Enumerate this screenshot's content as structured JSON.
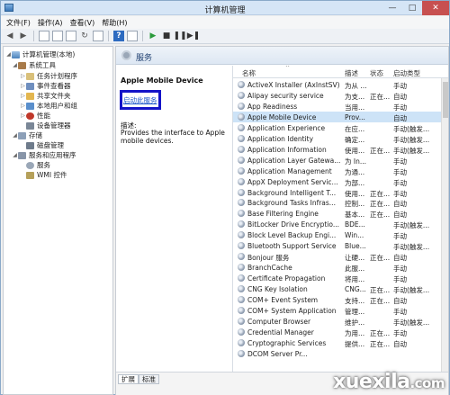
{
  "window": {
    "title": "计算机管理",
    "controls": [
      "—",
      "□",
      "✕"
    ]
  },
  "menubar": {
    "items": [
      "文件(F)",
      "操作(A)",
      "查看(V)",
      "帮助(H)"
    ]
  },
  "tree": {
    "items": [
      {
        "label": "计算机管理(本地)",
        "icon": "computer-icon"
      },
      {
        "label": "系统工具",
        "icon": "tools-icon"
      },
      {
        "label": "任务计划程序",
        "icon": "task-scheduler-icon"
      },
      {
        "label": "事件查看器",
        "icon": "event-viewer-icon"
      },
      {
        "label": "共享文件夹",
        "icon": "shared-folder-icon"
      },
      {
        "label": "本地用户和组",
        "icon": "users-icon"
      },
      {
        "label": "性能",
        "icon": "performance-icon"
      },
      {
        "label": "设备管理器",
        "icon": "device-manager-icon"
      },
      {
        "label": "存储",
        "icon": "storage-icon"
      },
      {
        "label": "磁盘管理",
        "icon": "disk-icon"
      },
      {
        "label": "服务和应用程序",
        "icon": "services-apps-icon"
      },
      {
        "label": "服务",
        "icon": "service-icon"
      },
      {
        "label": "WMI 控件",
        "icon": "wmi-icon"
      }
    ]
  },
  "services_panel": {
    "header": "服务",
    "selected_name": "Apple Mobile Device",
    "start_link": "启动此服务",
    "description_label": "描述:",
    "description": "Provides the interface to Apple mobile devices.",
    "columns": [
      "名称",
      "描述",
      "状态",
      "启动类型"
    ],
    "sort_indicator": "^",
    "rows": [
      {
        "name": "ActiveX Installer (AxInstSV)",
        "desc": "为从 ...",
        "status": "",
        "startup": "手动"
      },
      {
        "name": "Alipay security service",
        "desc": "为支...",
        "status": "正在...",
        "startup": "自动"
      },
      {
        "name": "App Readiness",
        "desc": "当用...",
        "status": "",
        "startup": "手动"
      },
      {
        "name": "Apple Mobile Device",
        "desc": "Prov...",
        "status": "",
        "startup": "自动"
      },
      {
        "name": "Application Experience",
        "desc": "在应...",
        "status": "",
        "startup": "手动(触发..."
      },
      {
        "name": "Application Identity",
        "desc": "确定...",
        "status": "",
        "startup": "手动(触发..."
      },
      {
        "name": "Application Information",
        "desc": "使用...",
        "status": "正在...",
        "startup": "手动(触发..."
      },
      {
        "name": "Application Layer Gatewa...",
        "desc": "为 In...",
        "status": "",
        "startup": "手动"
      },
      {
        "name": "Application Management",
        "desc": "为通...",
        "status": "",
        "startup": "手动"
      },
      {
        "name": "AppX Deployment Servic...",
        "desc": "为部...",
        "status": "",
        "startup": "手动"
      },
      {
        "name": "Background Intelligent T...",
        "desc": "使用...",
        "status": "正在...",
        "startup": "手动"
      },
      {
        "name": "Background Tasks Infras...",
        "desc": "控制...",
        "status": "正在...",
        "startup": "自动"
      },
      {
        "name": "Base Filtering Engine",
        "desc": "基本...",
        "status": "正在...",
        "startup": "自动"
      },
      {
        "name": "BitLocker Drive Encryptio...",
        "desc": "BDE...",
        "status": "",
        "startup": "手动(触发..."
      },
      {
        "name": "Block Level Backup Engi...",
        "desc": "Win...",
        "status": "",
        "startup": "手动"
      },
      {
        "name": "Bluetooth Support Service",
        "desc": "Blue...",
        "status": "",
        "startup": "手动(触发..."
      },
      {
        "name": "Bonjour 服务",
        "desc": "让硬...",
        "status": "正在...",
        "startup": "自动"
      },
      {
        "name": "BranchCache",
        "desc": "此服...",
        "status": "",
        "startup": "手动"
      },
      {
        "name": "Certificate Propagation",
        "desc": "将用...",
        "status": "",
        "startup": "手动"
      },
      {
        "name": "CNG Key Isolation",
        "desc": "CNG...",
        "status": "正在...",
        "startup": "手动(触发..."
      },
      {
        "name": "COM+ Event System",
        "desc": "支持...",
        "status": "正在...",
        "startup": "自动"
      },
      {
        "name": "COM+ System Application",
        "desc": "管理...",
        "status": "",
        "startup": "手动"
      },
      {
        "name": "Computer Browser",
        "desc": "维护...",
        "status": "",
        "startup": "手动(触发..."
      },
      {
        "name": "Credential Manager",
        "desc": "为用...",
        "status": "正在...",
        "startup": "手动"
      },
      {
        "name": "Cryptographic Services",
        "desc": "提供...",
        "status": "正在...",
        "startup": "自动"
      },
      {
        "name": "DCOM Server Pr...",
        "desc": "",
        "status": "",
        "startup": ""
      }
    ],
    "tabs": [
      "扩展",
      "标准"
    ]
  },
  "watermark": {
    "brand": "xuexila",
    "domain": ".com"
  },
  "colors": {
    "selection": "#cde3f7",
    "highlight_box": "#1414c8",
    "link": "#1c57c9"
  }
}
